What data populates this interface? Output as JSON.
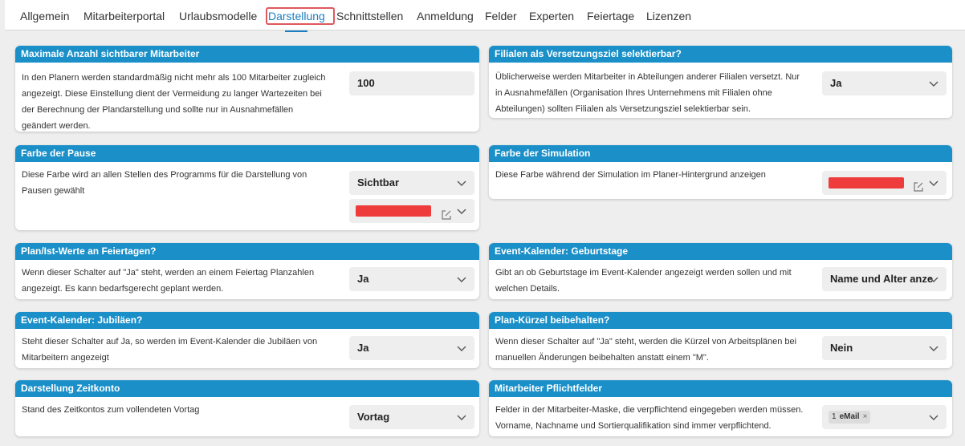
{
  "tabs": [
    {
      "label": "Allgemein"
    },
    {
      "label": "Mitarbeiterportal"
    },
    {
      "label": "Urlaubsmodelle"
    },
    {
      "label": "Darstellung"
    },
    {
      "label": "Schnittstellen"
    },
    {
      "label": "Anmeldung"
    },
    {
      "label": "Felder"
    },
    {
      "label": "Experten"
    },
    {
      "label": "Feiertage"
    },
    {
      "label": "Lizenzen"
    }
  ],
  "active_tab": "Darstellung",
  "colors": {
    "header_blue": "#1a8fc8",
    "active_tab": "#1a7fc1",
    "highlight_box": "#e0575d",
    "color_swatch": "#ee3c3c"
  },
  "cards": {
    "max_employees": {
      "title": "Maximale Anzahl sichtbarer Mitarbeiter",
      "desc": [
        "In den Planern werden standardmäßig nicht mehr als 100 Mitarbeiter zugleich",
        "angezeigt. Diese Einstellung dient der Vermeidung zu langer Wartezeiten bei",
        "der Berechnung der Plandarstellung und sollte nur in Ausnahmefällen",
        "geändert werden."
      ],
      "value": "100"
    },
    "branches_target": {
      "title": "Filialen als Versetzungsziel selektierbar?",
      "desc": [
        "Üblicherweise werden Mitarbeiter in Abteilungen anderer Filialen versetzt. Nur",
        "in Ausnahmefällen (Organisation Ihres Unternehmens mit Filialen ohne",
        "Abteilungen) sollten Filialen als Versetzungsziel selektierbar sein."
      ],
      "value": "Ja"
    },
    "pause_color": {
      "title": "Farbe der Pause",
      "desc": [
        "Diese Farbe wird an allen Stellen des Programms für die Darstellung von",
        "Pausen gewählt"
      ],
      "value": "Sichtbar"
    },
    "simulation_color": {
      "title": "Farbe der Simulation",
      "desc": [
        "Diese Farbe während der Simulation im Planer-Hintergrund anzeigen"
      ]
    },
    "holiday_values": {
      "title": "Plan/Ist-Werte an Feiertagen?",
      "desc": [
        "Wenn dieser Schalter auf \"Ja\" steht, werden an einem Feiertag Planzahlen",
        "angezeigt. Es kann bedarfsgerecht geplant werden."
      ],
      "value": "Ja"
    },
    "birthdays": {
      "title": "Event-Kalender: Geburtstage",
      "desc": [
        "Gibt an ob Geburtstage im Event-Kalender angezeigt werden sollen und mit",
        "welchen Details."
      ],
      "value": "Name und Alter anze"
    },
    "jubilees": {
      "title": "Event-Kalender: Jubiläen?",
      "desc": [
        "Steht dieser Schalter auf Ja, so werden im Event-Kalender die Jubiläen von",
        "Mitarbeitern angezeigt"
      ],
      "value": "Ja"
    },
    "plan_abbrev": {
      "title": "Plan-Kürzel beibehalten?",
      "desc": [
        "Wenn dieser Schalter auf \"Ja\" steht, werden die Kürzel von Arbeitsplänen bei",
        "manuellen Änderungen beibehalten anstatt einem \"M\"."
      ],
      "value": "Nein"
    },
    "time_account": {
      "title": "Darstellung Zeitkonto",
      "desc": [
        "Stand des Zeitkontos zum vollendeten Vortag"
      ],
      "value": "Vortag"
    },
    "required_fields": {
      "title": "Mitarbeiter Pflichtfelder",
      "desc": [
        "Felder in der Mitarbeiter-Maske, die verpflichtend eingegeben werden müssen.",
        "Vorname, Nachname und Sortierqualifikation sind immer verpflichtend."
      ],
      "chip_count": "1",
      "chip_label": "eMail",
      "chip_remove": "×"
    }
  }
}
